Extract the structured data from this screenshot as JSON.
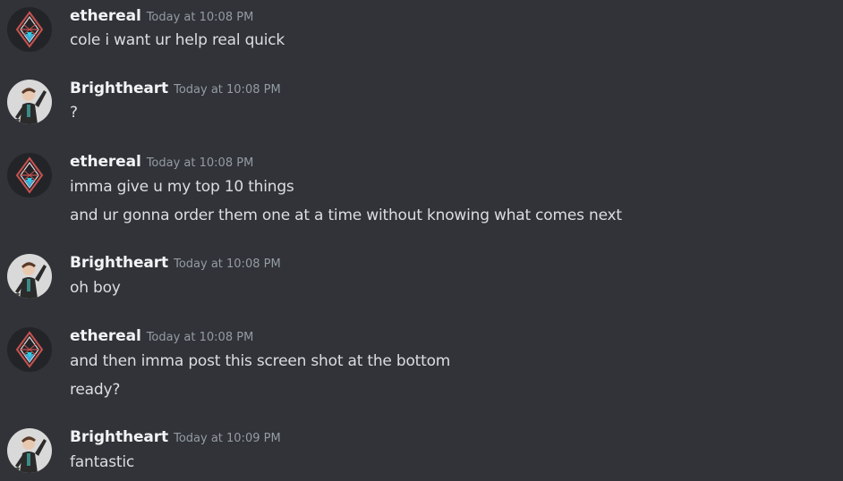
{
  "colors": {
    "background": "#313338",
    "username": "#f2f3f5",
    "text": "#dbdee1",
    "timestamp": "#949ba4"
  },
  "messages": [
    {
      "author": "ethereal",
      "avatar": "ethereal-diamond-avatar-icon",
      "timestamp": "Today at 10:08 PM",
      "lines": [
        "cole i want ur help real quick"
      ]
    },
    {
      "author": "Brightheart",
      "avatar": "brightheart-character-avatar-icon",
      "timestamp": "Today at 10:08 PM",
      "lines": [
        "?"
      ]
    },
    {
      "author": "ethereal",
      "avatar": "ethereal-diamond-avatar-icon",
      "timestamp": "Today at 10:08 PM",
      "lines": [
        "imma give u my top 10 things",
        "and ur gonna order them one at a time without knowing what comes next"
      ]
    },
    {
      "author": "Brightheart",
      "avatar": "brightheart-character-avatar-icon",
      "timestamp": "Today at 10:08 PM",
      "lines": [
        "oh boy"
      ]
    },
    {
      "author": "ethereal",
      "avatar": "ethereal-diamond-avatar-icon",
      "timestamp": "Today at 10:08 PM",
      "lines": [
        "and then imma post this screen shot at the bottom",
        "ready?"
      ]
    },
    {
      "author": "Brightheart",
      "avatar": "brightheart-character-avatar-icon",
      "timestamp": "Today at 10:09 PM",
      "lines": [
        "fantastic"
      ]
    }
  ]
}
